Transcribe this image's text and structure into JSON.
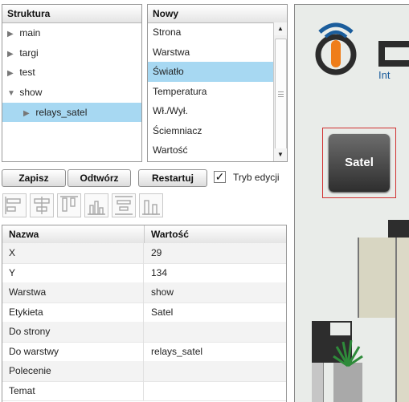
{
  "struktura": {
    "title": "Struktura",
    "items": [
      {
        "label": "main",
        "arrow": "▶"
      },
      {
        "label": "targi",
        "arrow": "▶"
      },
      {
        "label": "test",
        "arrow": "▶"
      },
      {
        "label": "show",
        "arrow": "▼"
      },
      {
        "label": "relays_satel",
        "arrow": "▶",
        "selected": true
      }
    ]
  },
  "nowy": {
    "title": "Nowy",
    "items": [
      "Strona",
      "Warstwa",
      "Światło",
      "Temperatura",
      "Wł./Wył.",
      "Ściemniacz",
      "Wartość"
    ],
    "selected": "Światło",
    "scroll_up": "▲",
    "scroll_down": "▼"
  },
  "toolbar": {
    "save_label": "Zapisz",
    "open_label": "Odtwórz",
    "restart_label": "Restartuj",
    "edit_mode_label": "Tryb edycji",
    "edit_mode_checked": true,
    "check_mark": "✓"
  },
  "tools": [
    "align-left-icon",
    "align-center-icon",
    "align-top-icon",
    "chart-icon",
    "distribute-icon",
    "align-bottom-icon"
  ],
  "properties": {
    "col_name": "Nazwa",
    "col_value": "Wartość",
    "rows": [
      {
        "name": "X",
        "value": "29"
      },
      {
        "name": "Y",
        "value": "134"
      },
      {
        "name": "Warstwa",
        "value": "show"
      },
      {
        "name": "Etykieta",
        "value": "Satel"
      },
      {
        "name": "Do strony",
        "value": ""
      },
      {
        "name": "Do warstwy",
        "value": "relays_satel"
      },
      {
        "name": "Polecenie",
        "value": ""
      },
      {
        "name": "Temat",
        "value": ""
      }
    ]
  },
  "canvas": {
    "logo_letter": "D",
    "logo_sub": "Int",
    "satel_button_label": "Satel",
    "accent": "#ef7d1a",
    "brand_blue": "#1b5d9c"
  }
}
